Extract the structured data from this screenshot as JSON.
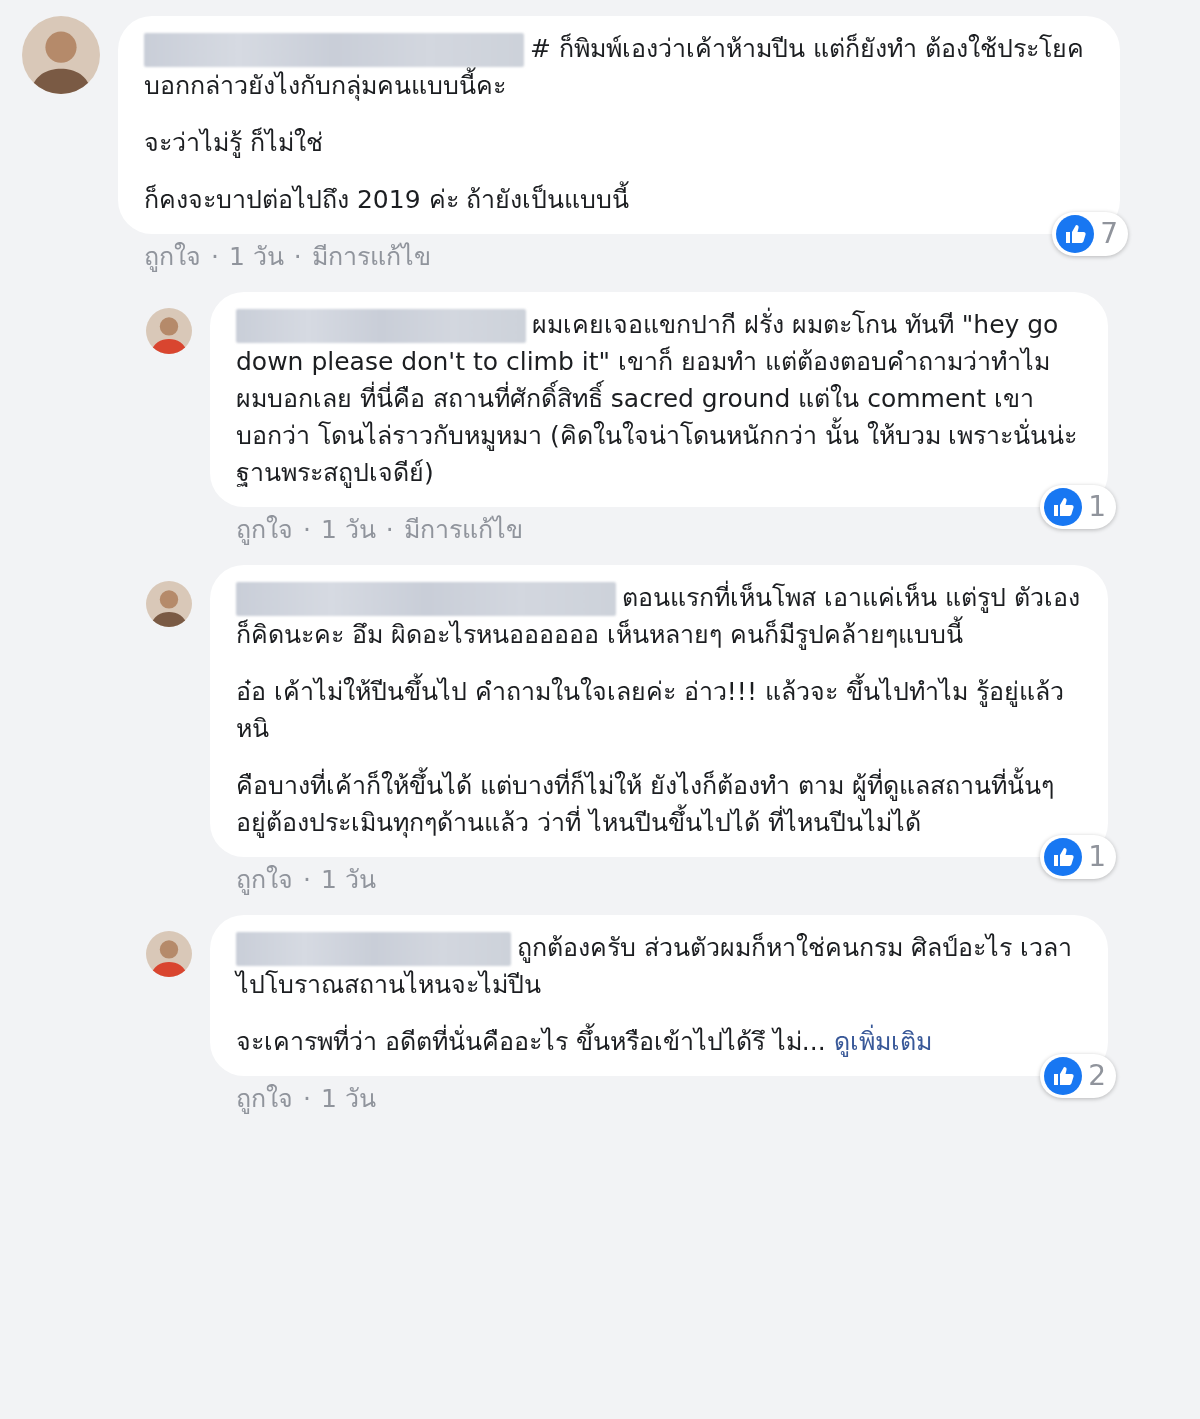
{
  "comments": [
    {
      "reply": false,
      "paragraphs": [
        "# ก็พิมพ์เองว่าเค้าห้ามปีน แต่ก็ยังทำ ต้องใช้ประโยคบอกกล่าวยังไงกับกลุ่มคนแบบนี้คะ",
        "จะว่าไม่รู้ ก็ไม่ใช่",
        "ก็คงจะบาปต่อไปถึง 2019 ค่ะ ถ้ายังเป็นแบบนี้"
      ],
      "likes": "7",
      "footer": [
        "ถูกใจ",
        "·",
        "1 วัน",
        "·",
        "มีการแก้ไข"
      ]
    },
    {
      "reply": true,
      "paragraphs": [
        "ผมเคยเจอแขกปากี ฝรั่ง ผมตะโกน ทันที \"hey go down please don't to climb it\" เขาก็ ยอมทำ แต่ต้องตอบคำถามว่าทำไม ผมบอกเลย ที่นี่คือ สถานที่ศักดิ์สิทธิ์ sacred ground แต่ใน comment เขา บอกว่า โดนไล่ราวกับหมูหมา (คิดในใจน่าโดนหนักกว่า นั้น ให้บวม เพราะนั่นน่ะฐานพระสถูปเจดีย์)"
      ],
      "likes": "1",
      "footer": [
        "ถูกใจ",
        "·",
        "1 วัน",
        "·",
        "มีการแก้ไข"
      ]
    },
    {
      "reply": true,
      "paragraphs": [
        "ตอนแรกที่เห็นโพส เอาแค่เห็น แต่รูป ตัวเองก็คิดนะคะ อึม ผิดอะไรหนออออออ เห็นหลายๆ คนก็มีรูปคล้ายๆแบบนี้",
        "อ๋อ เค้าไม่ให้ปีนขึ้นไป คำถามในใจเลยค่ะ อ่าว!!! แล้วจะ ขึ้นไปทำไม รู้อยู่แล้วหนิ",
        "คือบางที่เค้าก็ให้ขึ้นได้ แต่บางที่ก็ไม่ให้ ยังไงก็ต้องทำ ตาม ผู้ที่ดูแลสถานที่นั้นๆอยู่ต้องประเมินทุกๆด้านแล้ว ว่าที่ ไหนปีนขึ้นไปได้ ที่ไหนปีนไม่ได้"
      ],
      "likes": "1",
      "footer": [
        "ถูกใจ",
        "·",
        "1 วัน"
      ]
    },
    {
      "reply": true,
      "paragraphs": [
        "ถูกต้องครับ ส่วนตัวผมก็หาใช่คนกรม ศิลป์อะไร เวลาไปโบราณสถานไหนจะไม่ปีน",
        "จะเคารพที่ว่า อดีตที่นั่นคืออะไร ขึ้นหรือเข้าไปได้รึ ไม่..."
      ],
      "see_more": "ดูเพิ่มเติม",
      "likes": "2",
      "footer": [
        "ถูกใจ",
        "·",
        "1 วัน"
      ]
    }
  ]
}
